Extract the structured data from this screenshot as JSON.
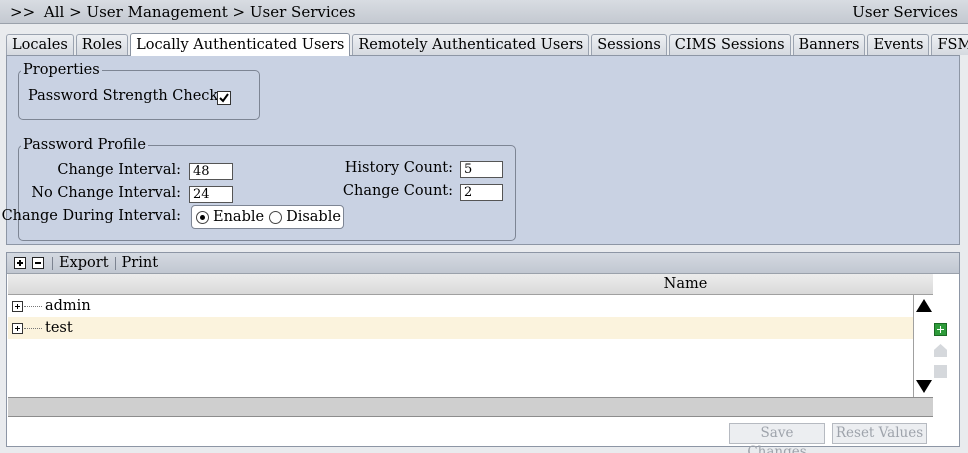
{
  "header": {
    "prefix": ">>",
    "breadcrumb": "All > User Management > User Services",
    "title_right": "User Services"
  },
  "tabs": [
    {
      "label": "Locales",
      "active": false
    },
    {
      "label": "Roles",
      "active": false
    },
    {
      "label": "Locally Authenticated Users",
      "active": true
    },
    {
      "label": "Remotely Authenticated Users",
      "active": false
    },
    {
      "label": "Sessions",
      "active": false
    },
    {
      "label": "CIMS Sessions",
      "active": false
    },
    {
      "label": "Banners",
      "active": false
    },
    {
      "label": "Events",
      "active": false
    },
    {
      "label": "FSM",
      "active": false
    }
  ],
  "properties": {
    "legend": "Properties",
    "password_strength_label": "Password Strength Check:",
    "password_strength_checked": true
  },
  "password_profile": {
    "legend": "Password Profile",
    "change_interval_label": "Change Interval:",
    "change_interval_value": "48",
    "no_change_interval_label": "No Change Interval:",
    "no_change_interval_value": "24",
    "change_during_interval_label": "Change During Interval:",
    "enable_label": "Enable",
    "disable_label": "Disable",
    "selected": "Enable",
    "history_count_label": "History Count:",
    "history_count_value": "5",
    "change_count_label": "Change Count:",
    "change_count_value": "2"
  },
  "toolbar": {
    "export_label": "Export",
    "print_label": "Print"
  },
  "grid": {
    "column_name": "Name",
    "rows": [
      {
        "name": "admin"
      },
      {
        "name": "test"
      }
    ]
  },
  "buttons": {
    "save_label": "Save Changes",
    "reset_label": "Reset Values"
  }
}
